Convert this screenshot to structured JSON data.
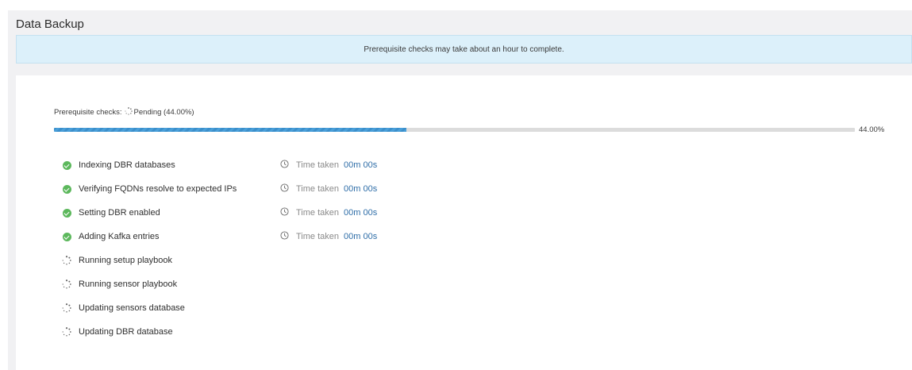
{
  "page": {
    "title": "Data Backup"
  },
  "banner": {
    "message": "Prerequisite checks may take about an hour to complete."
  },
  "status": {
    "prefix": "Prerequisite checks:",
    "state": "Pending (44.00%)",
    "progress_percent": 44.0,
    "progress_label": "44.00%"
  },
  "colors": {
    "success": "#5cb85c",
    "accent": "#3b8fcb",
    "time_value": "#2f6ea8",
    "banner_bg": "#dcf0fa"
  },
  "steps": [
    {
      "label": "Indexing DBR databases",
      "status": "done",
      "time_label": "Time taken",
      "time_value": "00m 00s"
    },
    {
      "label": "Verifying FQDNs resolve to expected IPs",
      "status": "done",
      "time_label": "Time taken",
      "time_value": "00m 00s"
    },
    {
      "label": "Setting DBR enabled",
      "status": "done",
      "time_label": "Time taken",
      "time_value": "00m 00s"
    },
    {
      "label": "Adding Kafka entries",
      "status": "done",
      "time_label": "Time taken",
      "time_value": "00m 00s"
    },
    {
      "label": "Running setup playbook",
      "status": "pending"
    },
    {
      "label": "Running sensor playbook",
      "status": "pending"
    },
    {
      "label": "Updating sensors database",
      "status": "pending"
    },
    {
      "label": "Updating DBR database",
      "status": "pending"
    }
  ],
  "icons": {
    "done": "check-circle-icon",
    "pending": "spinner-icon",
    "time": "clock-icon"
  }
}
